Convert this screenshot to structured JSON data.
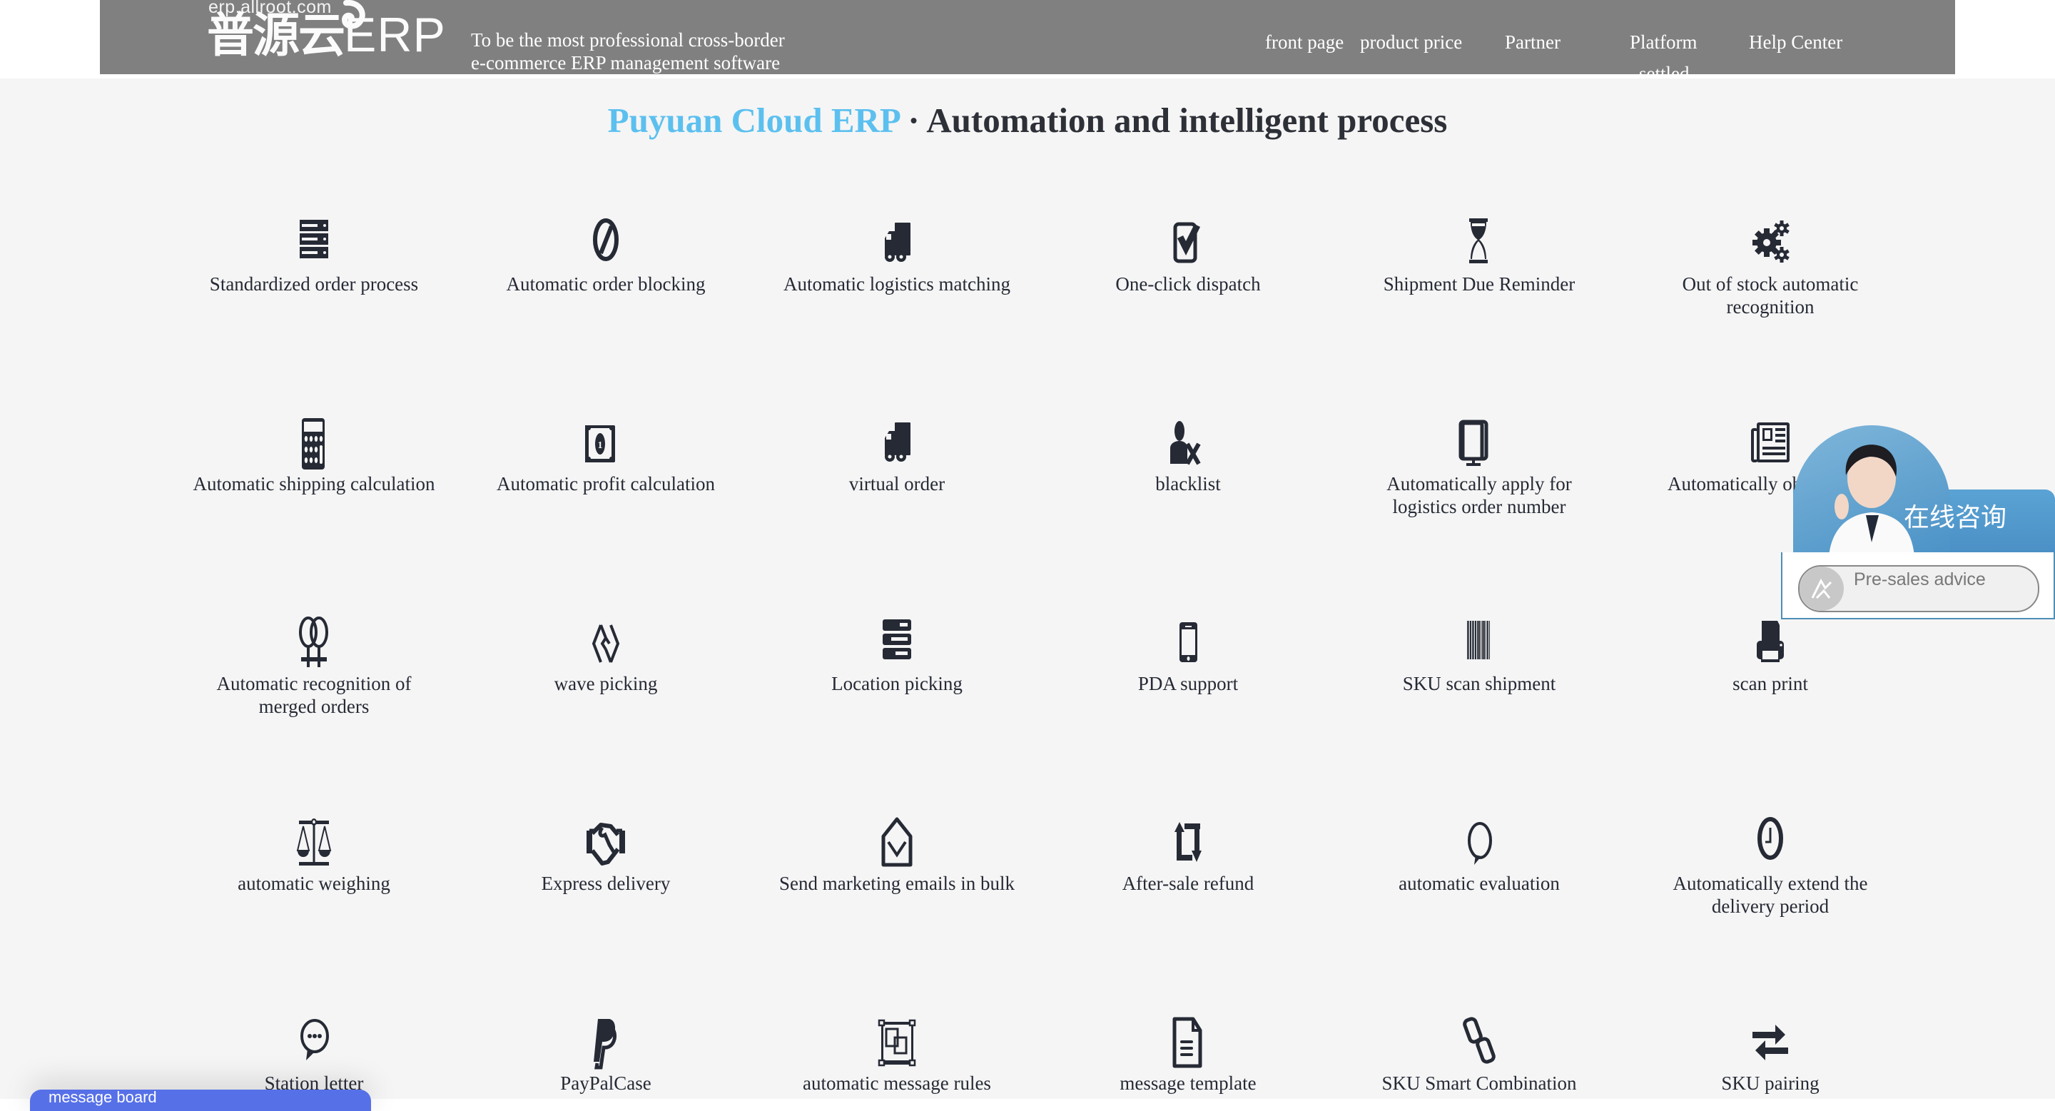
{
  "header": {
    "logo_domain": "erp.allroot.com",
    "logo_cn": "普源云",
    "logo_erp": "ERP",
    "tagline_line1": "To be the most professional cross-border",
    "tagline_line2": "e-commerce ERP management software",
    "nav": [
      {
        "label": "front page"
      },
      {
        "label": "product price"
      },
      {
        "label": "Partner"
      },
      {
        "label": "Platform",
        "label_line2": "settled"
      },
      {
        "label": "Help Center"
      }
    ]
  },
  "section": {
    "title_brand": "Puyuan Cloud ERP",
    "title_separator": " · ",
    "title_rest": "Automation and intelligent process",
    "brand_color": "#5cc0ef"
  },
  "features": [
    {
      "label": "Standardized order process",
      "icon": "server-icon"
    },
    {
      "label": "Automatic order blocking",
      "icon": "ban-icon"
    },
    {
      "label": "Automatic logistics matching",
      "icon": "truck-icon"
    },
    {
      "label": "One-click dispatch",
      "icon": "check-square-icon"
    },
    {
      "label": "Shipment Due Reminder",
      "icon": "hourglass-icon"
    },
    {
      "label": "Out of stock automatic recognition",
      "icon": "cogs-icon"
    },
    {
      "label": "Automatic shipping calculation",
      "icon": "calculator-icon"
    },
    {
      "label": "Automatic profit calculation",
      "icon": "money-bill-icon"
    },
    {
      "label": "virtual order",
      "icon": "truck-icon"
    },
    {
      "label": "blacklist",
      "icon": "user-times-icon"
    },
    {
      "label": "Automatically apply for logistics order number",
      "icon": "monitor-icon"
    },
    {
      "label": "Automatically obtain label",
      "icon": "newspaper-icon"
    },
    {
      "label": "Automatic recognition of merged orders",
      "icon": "venus-double-icon"
    },
    {
      "label": "wave picking",
      "icon": "wave-diamond-icon"
    },
    {
      "label": "Location picking",
      "icon": "server-block-icon"
    },
    {
      "label": "PDA support",
      "icon": "mobile-icon"
    },
    {
      "label": "SKU scan shipment",
      "icon": "barcode-icon"
    },
    {
      "label": "scan print",
      "icon": "printer-icon"
    },
    {
      "label": "automatic weighing",
      "icon": "balance-scale-icon"
    },
    {
      "label": "Express delivery",
      "icon": "handshake-icon"
    },
    {
      "label": "Send marketing emails in bulk",
      "icon": "envelope-open-icon"
    },
    {
      "label": "After-sale refund",
      "icon": "retweet-icon"
    },
    {
      "label": "automatic evaluation",
      "icon": "comment-icon"
    },
    {
      "label": "Automatically extend the delivery period",
      "icon": "clock-icon"
    },
    {
      "label": "Station letter",
      "icon": "commenting-icon"
    },
    {
      "label": "PayPalCase",
      "icon": "paypal-icon"
    },
    {
      "label": "automatic message rules",
      "icon": "object-group-icon"
    },
    {
      "label": "message template",
      "icon": "file-text-icon"
    },
    {
      "label": "SKU Smart Combination",
      "icon": "chain-icon"
    },
    {
      "label": "SKU pairing",
      "icon": "exchange-icon"
    }
  ],
  "chat_widget": {
    "title": "在线咨询",
    "button_label": "Pre-sales advice"
  },
  "message_board": {
    "label": "message board"
  }
}
